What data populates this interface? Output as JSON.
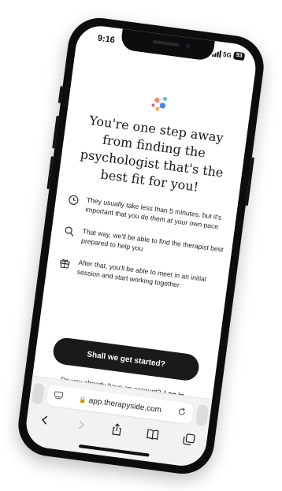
{
  "status_bar": {
    "time": "9:16",
    "network": "5G",
    "battery": "93"
  },
  "logo": {
    "icon": "therapyside-logo-icon",
    "colors": [
      "#f28b6b",
      "#6bc5c3",
      "#4c7ff0",
      "#f0b74c",
      "#e25b8b"
    ]
  },
  "headline": "You're one step away from finding the psychologist that's the best fit for you!",
  "benefits": [
    {
      "icon": "clock-icon",
      "text": "They usually take less than 5 minutes, but it's important that you do them at your own pace"
    },
    {
      "icon": "search-icon",
      "text": "That way, we'll be able to find the therapist best prepared to help you"
    },
    {
      "icon": "gift-icon",
      "text": "After that, you'll be able to meet in an initial session and start working together"
    }
  ],
  "cta": {
    "label": "Shall we get started?"
  },
  "login": {
    "prompt": "Do you already have an account?",
    "link": "Log in"
  },
  "browser": {
    "url": "app.therapyside.com",
    "toolbar": [
      "back-icon",
      "forward-icon",
      "share-icon",
      "bookmarks-icon",
      "tabs-icon"
    ]
  },
  "colors": {
    "button_bg": "#1a1a1a",
    "text": "#1a1a1a",
    "browser_bg": "#f2f2f2"
  }
}
